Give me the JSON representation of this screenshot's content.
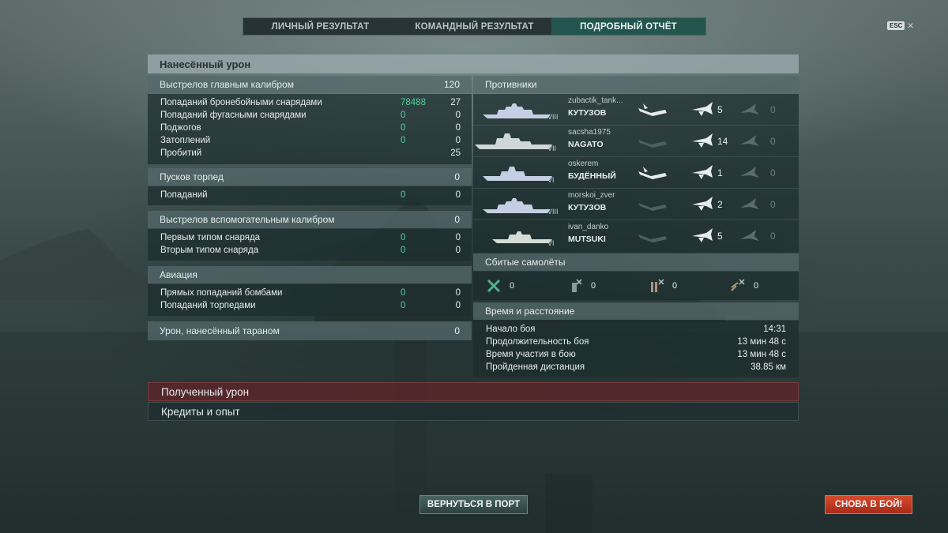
{
  "tabs": [
    "ЛИЧНЫЙ РЕЗУЛЬТАТ",
    "КОМАНДНЫЙ РЕЗУЛЬТАТ",
    "ПОДРОБНЫЙ ОТЧЁТ"
  ],
  "active_tab": 2,
  "esc_key": "ESC",
  "close_glyph": "×",
  "damage_header": "Нанесённый урон",
  "main_battery": {
    "title": "Выстрелов главным калибром",
    "total": "120",
    "rows": [
      {
        "label": "Попаданий бронебойными снарядами",
        "dmg": "78488",
        "count": "27"
      },
      {
        "label": "Попаданий фугасными снарядами",
        "dmg": "0",
        "count": "0"
      },
      {
        "label": "Поджогов",
        "dmg": "0",
        "count": "0"
      },
      {
        "label": "Затоплений",
        "dmg": "0",
        "count": "0"
      },
      {
        "label": "Пробитий",
        "dmg": "",
        "count": "25"
      }
    ]
  },
  "torpedoes": {
    "title": "Пусков торпед",
    "total": "0",
    "rows": [
      {
        "label": "Попаданий",
        "dmg": "0",
        "count": "0"
      }
    ]
  },
  "secondary": {
    "title": "Выстрелов вспомогательным калибром",
    "total": "0",
    "rows": [
      {
        "label": "Первым типом снаряда",
        "dmg": "0",
        "count": "0"
      },
      {
        "label": "Вторым типом снаряда",
        "dmg": "0",
        "count": "0"
      }
    ]
  },
  "aviation": {
    "title": "Авиация",
    "rows": [
      {
        "label": "Прямых попаданий бомбами",
        "dmg": "0",
        "count": "0"
      },
      {
        "label": "Попаданий торпедами",
        "dmg": "0",
        "count": "0"
      }
    ]
  },
  "ram": {
    "title": "Урон, нанесённый тараном",
    "total": "0"
  },
  "enemies": {
    "title": "Противники",
    "list": [
      {
        "player": "zubactik_tank...",
        "ship": "КУТУЗОВ",
        "tier": "VIII",
        "sunk": true,
        "spotted": "5",
        "planes": "0"
      },
      {
        "player": "sacsha1975",
        "ship": "NAGATO",
        "tier": "VII",
        "sunk": false,
        "spotted": "14",
        "planes": "0"
      },
      {
        "player": "oskerem",
        "ship": "БУДЁННЫЙ",
        "tier": "VI",
        "sunk": true,
        "spotted": "1",
        "planes": "0"
      },
      {
        "player": "morskoi_zver",
        "ship": "КУТУЗОВ",
        "tier": "VIII",
        "sunk": false,
        "spotted": "2",
        "planes": "0"
      },
      {
        "player": "ivan_danko",
        "ship": "MUTSUKI",
        "tier": "VI",
        "sunk": false,
        "spotted": "5",
        "planes": "0"
      }
    ]
  },
  "planes": {
    "title": "Сбитые самолёты",
    "items": [
      {
        "icon": "fighter-icon",
        "value": "0"
      },
      {
        "icon": "bomber-icon",
        "value": "0"
      },
      {
        "icon": "torpedo-bomber-icon",
        "value": "0"
      },
      {
        "icon": "spotter-icon",
        "value": "0"
      }
    ]
  },
  "time": {
    "title": "Время и расстояние",
    "rows": [
      {
        "label": "Начало боя",
        "value": "14:31"
      },
      {
        "label": "Продолжительность боя",
        "value": "13 мин 48 с"
      },
      {
        "label": "Время участия в бою",
        "value": "13 мин 48 с"
      },
      {
        "label": "Пройденная дистанция",
        "value": "38.85 км"
      }
    ]
  },
  "received_damage": "Полученный урон",
  "credits_xp": "Кредиты и опыт",
  "buttons": {
    "port": "ВЕРНУТЬСЯ В ПОРТ",
    "battle": "СНОВА В БОЙ!"
  },
  "colors": {
    "accent_green": "#52cf9a",
    "active_tab": "#245a54",
    "received_bar": "#5a2a2c",
    "battle_button": "#c23a22"
  }
}
